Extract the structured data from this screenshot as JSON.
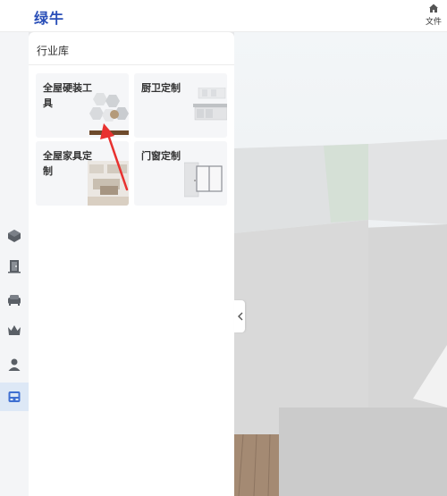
{
  "app": {
    "logo": "绿牛"
  },
  "toolbar": {
    "file_label": "文件"
  },
  "library": {
    "title": "行业库",
    "cards": [
      {
        "label": "全屋硬装工具"
      },
      {
        "label": "厨卫定制"
      },
      {
        "label": "全屋家具定制"
      },
      {
        "label": "门窗定制"
      }
    ]
  },
  "rail": {
    "items": [
      {
        "icon": "cube-icon"
      },
      {
        "icon": "door-icon"
      },
      {
        "icon": "sofa-icon"
      },
      {
        "icon": "crown-icon"
      },
      {
        "icon": "person-icon"
      },
      {
        "icon": "industry-library-icon",
        "active": true
      }
    ]
  },
  "colors": {
    "accent": "#2a4fb8",
    "active_bg": "#dde8f6",
    "annotation": "#e8312f"
  }
}
